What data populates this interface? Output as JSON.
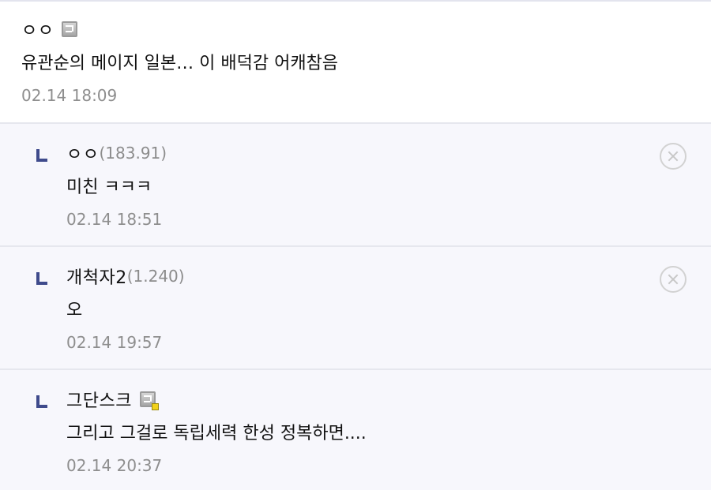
{
  "comments": [
    {
      "nickname": "ㅇㅇ",
      "ip": "",
      "badge_icon": "fixed-nick-icon",
      "text": "유관순의 메이지 일본… 이 배덕감 어캐참음",
      "date": "02.14 18:09"
    }
  ],
  "replies": [
    {
      "nickname": "ㅇㅇ",
      "ip": "(183.91)",
      "text": "미친 ㅋㅋㅋ",
      "date": "02.14 18:51",
      "delete_icon": "close-circle-icon"
    },
    {
      "nickname": "개척자2",
      "ip": "(1.240)",
      "text": "오",
      "date": "02.14 19:57",
      "delete_icon": "close-circle-icon"
    },
    {
      "nickname": "그단스크",
      "ip": "",
      "badge_icon": "fixed-nick-icon",
      "text": "그리고 그걸로 독립세력 한성 정복하면....",
      "date": "02.14 20:37"
    }
  ],
  "colors": {
    "reply_background": "#f7f7fc",
    "reply_arrow": "#3f4b8c",
    "date_text": "#8e8e8e",
    "divider": "#e6e7ee"
  }
}
